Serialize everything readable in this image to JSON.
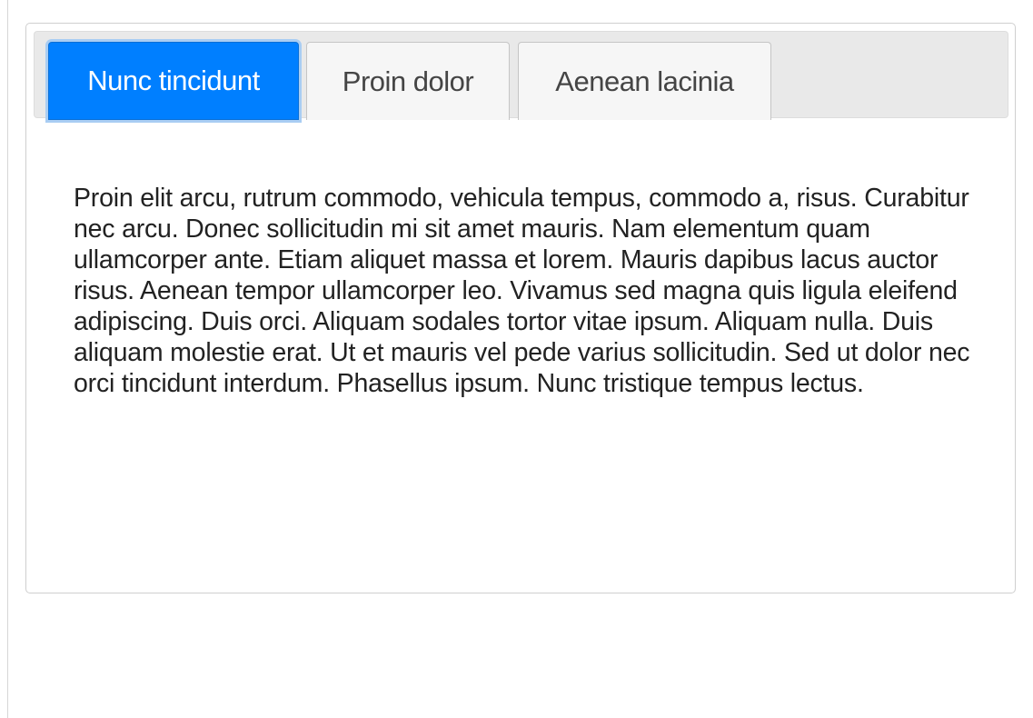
{
  "tabs": [
    {
      "label": "Nunc tincidunt",
      "active": true
    },
    {
      "label": "Proin dolor",
      "active": false
    },
    {
      "label": "Aenean lacinia",
      "active": false
    }
  ],
  "panel": {
    "text": "Proin elit arcu, rutrum commodo, vehicula tempus, commodo a, risus. Curabitur nec arcu. Donec sollicitudin mi sit amet mauris. Nam elementum quam ullamcorper ante. Etiam aliquet massa et lorem. Mauris dapibus lacus auctor risus. Aenean tempor ullamcorper leo. Vivamus sed magna quis ligula eleifend adipiscing. Duis orci. Aliquam sodales tortor vitae ipsum. Aliquam nulla. Duis aliquam molestie erat. Ut et mauris vel pede varius sollicitudin. Sed ut dolor nec orci tincidunt interdum. Phasellus ipsum. Nunc tristique tempus lectus."
  },
  "colors": {
    "active_tab_bg": "#007fff",
    "active_tab_text": "#ffffff",
    "inactive_tab_bg": "#f6f6f6",
    "inactive_tab_text": "#454545",
    "tab_bar_bg": "#e9e9e9",
    "panel_text": "#222222"
  }
}
